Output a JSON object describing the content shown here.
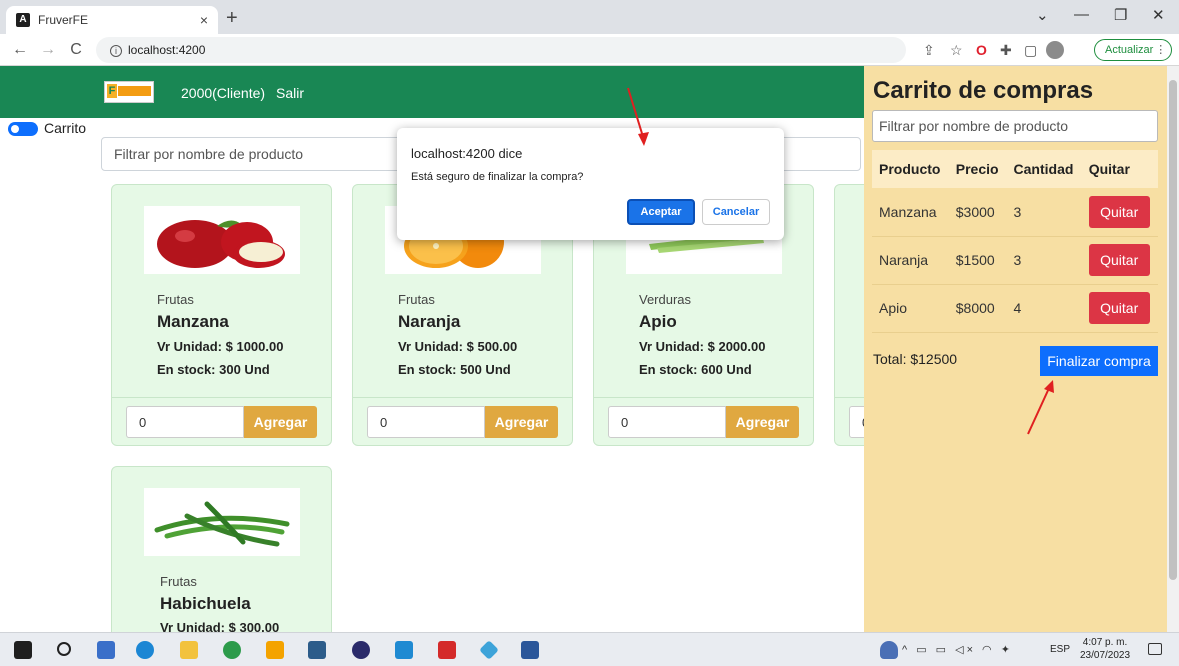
{
  "browser": {
    "tab_title": "FruverFE",
    "tab_close": "×",
    "new_tab": "+",
    "url": "localhost:4200",
    "update_label": "Actualizar",
    "win_min": "—",
    "win_restore": "❐",
    "win_close": "✕",
    "tab_list": "⌄"
  },
  "navbar": {
    "logo_letter": "F",
    "user": "2000(Cliente)",
    "logout": "Salir"
  },
  "toggle": {
    "label": "Carrito",
    "checked": true
  },
  "filter": {
    "placeholder": "Filtrar por nombre de producto"
  },
  "products": [
    {
      "category": "Frutas",
      "name": "Manzana",
      "price": "Vr Unidad: $ 1000.00",
      "stock": "En stock: 300 Und",
      "qty": "0",
      "add_label": "Agregar"
    },
    {
      "category": "Frutas",
      "name": "Naranja",
      "price": "Vr Unidad: $ 500.00",
      "stock": "En stock: 500 Und",
      "qty": "0",
      "add_label": "Agregar"
    },
    {
      "category": "Verduras",
      "name": "Apio",
      "price": "Vr Unidad: $ 2000.00",
      "stock": "En stock: 600 Und",
      "qty": "0",
      "add_label": "Agregar"
    },
    {
      "category": "Frutas",
      "name": "Habichuela",
      "price": "Vr Unidad: $ 300.00"
    }
  ],
  "partial_card_qty": "0",
  "dialog": {
    "title": "localhost:4200 dice",
    "message": "Está seguro de finalizar la compra?",
    "ok": "Aceptar",
    "cancel": "Cancelar"
  },
  "cart": {
    "title": "Carrito de compras",
    "filter_placeholder": "Filtrar por nombre de producto",
    "columns": [
      "Producto",
      "Precio",
      "Cantidad",
      "Quitar"
    ],
    "rows": [
      {
        "product": "Manzana",
        "price": "$3000",
        "qty": "3",
        "remove": "Quitar"
      },
      {
        "product": "Naranja",
        "price": "$1500",
        "qty": "3",
        "remove": "Quitar"
      },
      {
        "product": "Apio",
        "price": "$8000",
        "qty": "4",
        "remove": "Quitar"
      }
    ],
    "total": "Total: $12500",
    "checkout": "Finalizar compra"
  },
  "taskbar": {
    "lang": "ESP",
    "time": "4:07 p. m.",
    "date": "23/07/2023"
  },
  "colors": {
    "navbar": "#198754",
    "cart_bg": "#f7dfa3",
    "card_bg": "#e6f9e6",
    "add_button": "#e0a840",
    "remove_button": "#dc3545",
    "primary": "#0d6efd",
    "annotation_arrow": "#e02020"
  }
}
